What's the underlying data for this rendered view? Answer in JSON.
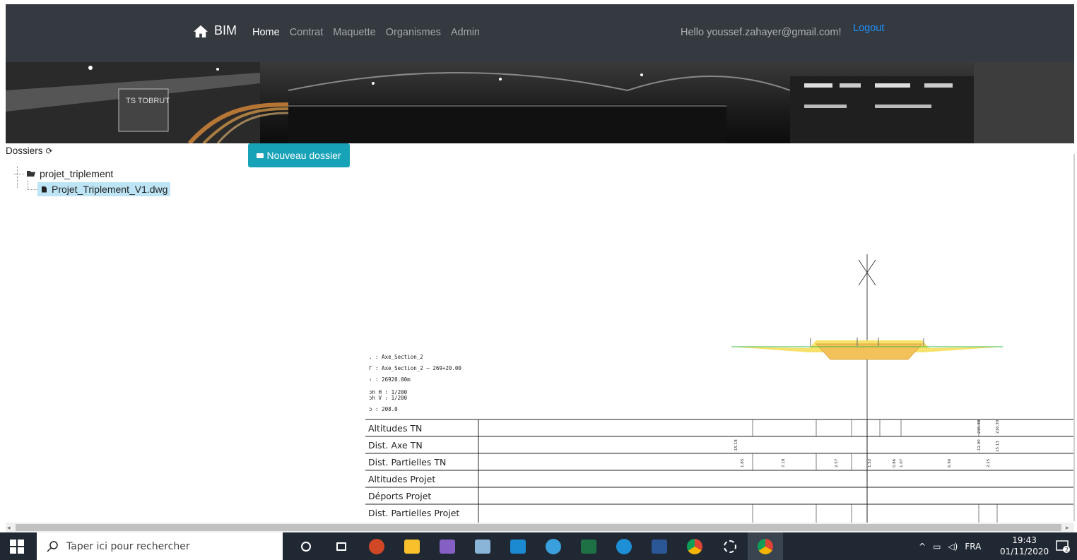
{
  "navbar": {
    "brand": "BIM",
    "links": [
      "Home",
      "Contrat",
      "Maquette",
      "Organismes",
      "Admin"
    ],
    "active": "Home",
    "greeting": "Hello youssef.zahayer@gmail.com!",
    "logout": "Logout"
  },
  "folders": {
    "title": "Dossiers",
    "new_folder_button": "Nouveau dossier",
    "tree": {
      "root": "projet_triplement",
      "children": [
        "Projet_Triplement_V1.dwg"
      ]
    }
  },
  "drawing": {
    "header_lines": [
      ". : Axe_Section_2",
      "Γ : Axe_Section_2 — 269+20.00",
      "‹ : 26920.00m",
      "ɔh H : 1/200",
      "ɔh V : 1/200",
      "ɔ : 208.0"
    ],
    "table_rows": [
      "Altitudes TN",
      "Dist. Axe TN",
      "Dist. Partielles TN",
      "Altitudes Projet",
      "Déports Projet",
      "Dist. Partielles Projet"
    ],
    "visible_values": [
      "1.85",
      "7.18",
      "2.57",
      "1.52",
      "0.86",
      "1.07",
      "6.90",
      "2.25",
      "215.38",
      "216.30",
      "-15.18",
      "-12.90",
      "15.13"
    ]
  },
  "taskbar": {
    "search_placeholder": "Taper ici pour rechercher",
    "language": "FRA",
    "time": "19:43",
    "date": "01/11/2020",
    "notification_count": "2",
    "apps": [
      {
        "name": "cortana",
        "color": "#ffffff"
      },
      {
        "name": "task-view",
        "color": "#ffffff"
      },
      {
        "name": "powerpoint",
        "color": "#d24726"
      },
      {
        "name": "file-explorer",
        "color": "#f8c12c"
      },
      {
        "name": "visual-studio",
        "color": "#865fc5"
      },
      {
        "name": "app-tools",
        "color": "#8ab4d8"
      },
      {
        "name": "civil-3d",
        "color": "#1b8ad1"
      },
      {
        "name": "paint",
        "color": "#3aa0dd"
      },
      {
        "name": "excel",
        "color": "#1e7145"
      },
      {
        "name": "edge",
        "color": "#1c8fd6"
      },
      {
        "name": "word",
        "color": "#2b5797"
      },
      {
        "name": "chrome",
        "color": "#f4b400"
      },
      {
        "name": "settings",
        "color": "#ffffff"
      },
      {
        "name": "chrome-active",
        "color": "#f4b400"
      }
    ]
  }
}
